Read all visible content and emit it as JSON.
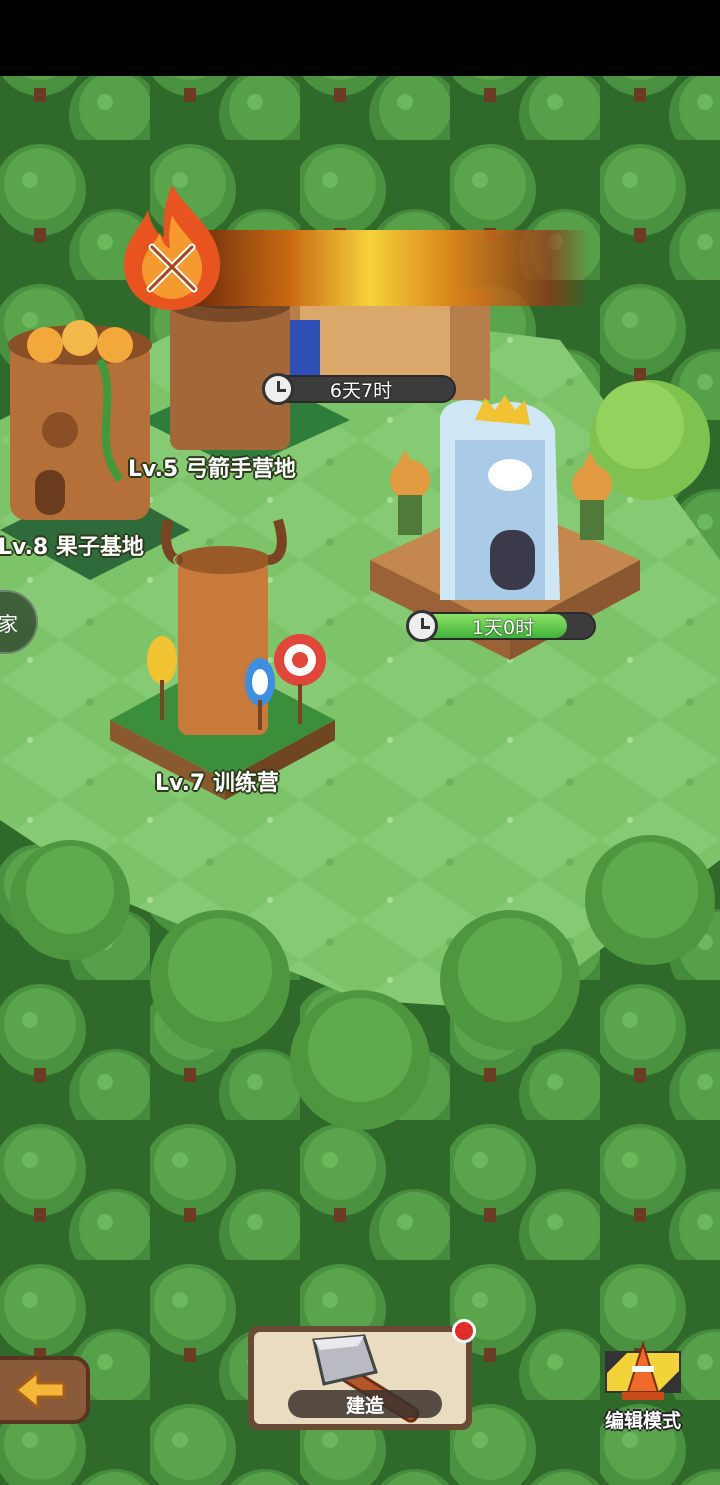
{
  "buildings": [
    {
      "label": "Lv.5 弓箭手营地"
    },
    {
      "label": "Lv.8 果子基地"
    },
    {
      "label": "Lv.7 训练营"
    }
  ],
  "timers": [
    {
      "text": "6天7时",
      "progress": 0.0
    },
    {
      "text": "1天0时",
      "progress": 0.85
    }
  ],
  "side_button": {
    "label": "家"
  },
  "bottom_bar": {
    "build_label": "建造",
    "edit_label": "编辑模式",
    "build_has_notification": true
  },
  "colors": {
    "grass": "#7cc36a",
    "forest": "#3e7f34",
    "banner": "#f5d23a",
    "notification": "#e02b2b"
  },
  "icons": [
    "flame-crossed-swords-icon",
    "clock-icon",
    "back-arrow-icon",
    "hammer-icon",
    "traffic-cone-icon"
  ]
}
